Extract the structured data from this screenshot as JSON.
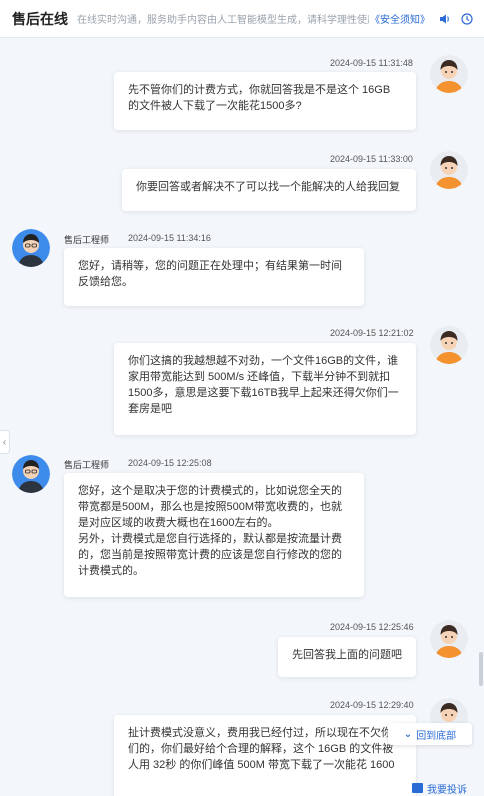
{
  "header": {
    "title": "售后在线",
    "notice": "在线实时沟通，服务助手内容由人工智能模型生成，请科学理性使用。",
    "notice_link": "《安全须知》",
    "icons": [
      "volume-icon",
      "clock-icon"
    ]
  },
  "messages": [
    {
      "sender": "",
      "side": "right",
      "time": "2024-09-15 11:31:48",
      "text": "先不管你们的计费方式，你就回答我是不是这个 16GB\n的文件被人下载了一次能花1500多?"
    },
    {
      "sender": "",
      "side": "right",
      "time": "2024-09-15 11:33:00",
      "text": "你要回答或者解决不了可以找一个能解决的人给我回复"
    },
    {
      "sender": "售后工程师",
      "side": "left",
      "time": "2024-09-15 11:34:16",
      "text": "您好，请稍等，您的问题正在处理中；有结果第一时间\n反馈给您。"
    },
    {
      "sender": "",
      "side": "right",
      "time": "2024-09-15 12:21:02",
      "text": "你们这搞的我越想越不对劲，一个文件16GB的文件，谁\n家用带宽能达到 500M/s 还峰值，下载半分钟不到就扣\n1500多，意思是这要下载16TB我早上起来还得欠你们一\n套房是吧"
    },
    {
      "sender": "售后工程师",
      "side": "left",
      "time": "2024-09-15 12:25:08",
      "text": "您好，这个是取决于您的计费模式的，比如说您全天的\n带宽都是500M，那么也是按照500M带宽收费的，也就\n是对应区域的收费大概也在1600左右的。\n另外，计费模式是您自行选择的，默认都是按流量计费\n的，您当前是按照带宽计费的应该是您自行修改的您的\n计费模式的。"
    },
    {
      "sender": "",
      "side": "right",
      "time": "2024-09-15 12:25:46",
      "text": "先回答我上面的问题吧"
    },
    {
      "sender": "",
      "side": "right",
      "time": "2024-09-15 12:29:40",
      "text": "扯计费模式没意义，费用我已经付过，所以现在不欠你\n们的，你们最好给个合理的解释，这个 16GB 的文件被\n人用 32秒 的你们峰值 500M 带宽下载了一次能花 1600"
    }
  ],
  "controls": {
    "back_to_bottom": "回到底部",
    "complaint": "我要投诉"
  },
  "colors": {
    "accent": "#2a6bd6",
    "background": "#f3f6fa",
    "bubble": "#ffffff"
  }
}
